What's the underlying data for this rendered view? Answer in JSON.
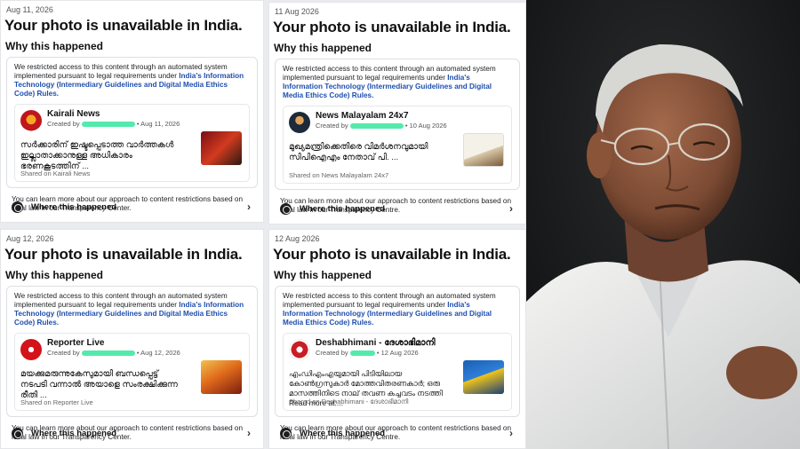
{
  "panels": [
    {
      "date": "Aug 11, 2026",
      "headline": "Your photo is unavailable in India.",
      "why": "Why this happened",
      "notice_start": "We restricted access to this content through an automated system implemented pursuant to legal requirements under ",
      "notice_link": "India's Information Technology (Intermediary Guidelines and Digital Media Ethics Code) Rules.",
      "page_name": "Kairali News",
      "created_by": "Created by",
      "created_date": "• Aug 11, 2026",
      "post_text": "സർക്കാരിന് ഇഷ്ടപ്പെടാത്ത വാർത്തകൾ ഇല്ലാതാക്കാനുള്ള അധികാരം ഭരണകൂടത്തിന് ...",
      "shared_on": "Shared on Kairali News",
      "learn_more": "You can learn more about our approach to content restrictions based on local law in our Transparency Center.",
      "where": "Where this happened",
      "accent": "#c0161d"
    },
    {
      "date": "11 Aug 2026",
      "headline": "Your photo is unavailable in India.",
      "why": "Why this happened",
      "notice_start": "We restricted access to this content through an automated system implemented pursuant to legal requirements under ",
      "notice_link": "India's Information Technology (Intermediary Guidelines and Digital Media Ethics Code) Rules.",
      "page_name": "News Malayalam 24x7",
      "created_by": "Created by",
      "created_date": "• 10 Aug 2026",
      "post_text": "മുഖ്യമന്ത്രിക്കെതിരെ വിമർശനവുമായി സിപിഐഎം നേതാവ് പി. ...",
      "shared_on": "Shared on News Malayalam 24x7",
      "learn_more": "You can learn more about our approach to content restrictions based on local law in our Transparency Centre.",
      "where": "Where this happened",
      "accent": "#1c2a3a"
    },
    {
      "date": "Aug 12, 2026",
      "headline": "Your photo is unavailable in India.",
      "why": "Why this happened",
      "notice_start": "We restricted access to this content through an automated system implemented pursuant to legal requirements under ",
      "notice_link": "India's Information Technology (Intermediary Guidelines and Digital Media Ethics Code) Rules.",
      "page_name": "Reporter Live",
      "created_by": "Created by",
      "created_date": "• Aug 12, 2026",
      "post_text": "മയക്കുമരുന്നുകേസുമായി ബന്ധപ്പെട്ട് നടപടി വന്നാൽ അയാളെ സംരക്ഷിക്കുന്ന രീതി ...",
      "shared_on": "Shared on Reporter Live",
      "learn_more": "You can learn more about our approach to content restrictions based on local law in our Transparency Center.",
      "where": "Where this happened",
      "accent": "#d3121a"
    },
    {
      "date": "12 Aug 2026",
      "headline": "Your photo is unavailable in India.",
      "why": "Why this happened",
      "notice_start": "We restricted access to this content through an automated system implemented pursuant to legal requirements under ",
      "notice_link": "India's Information Technology (Intermediary Guidelines and Digital Media Ethics Code) Rules.",
      "page_name": "Deshabhimani - ദേശാഭിമാനി",
      "created_by": "Created by",
      "created_date": "• 12 Aug 2026",
      "post_text": "എംഡിഎംഎയുമായി പിടിയിലായ കോൺഗ്രസുകാർ മോത്തവിതരണകാർ; ഒരു മാസത്തിനിടെ നാല് തവണ കച്ചവടം നടത്തി Read more at:...",
      "shared_on": "Shared on Deshabhimani - ദേശാഭിമാനി",
      "learn_more": "You can learn more about our approach to content restrictions based on local law in our Transparency Centre.",
      "where": "Where this happened",
      "accent": "#c81d25"
    }
  ],
  "colors": {
    "link": "#1f4fae",
    "redacted": "#35e69e",
    "photo_bg": "#141516"
  }
}
